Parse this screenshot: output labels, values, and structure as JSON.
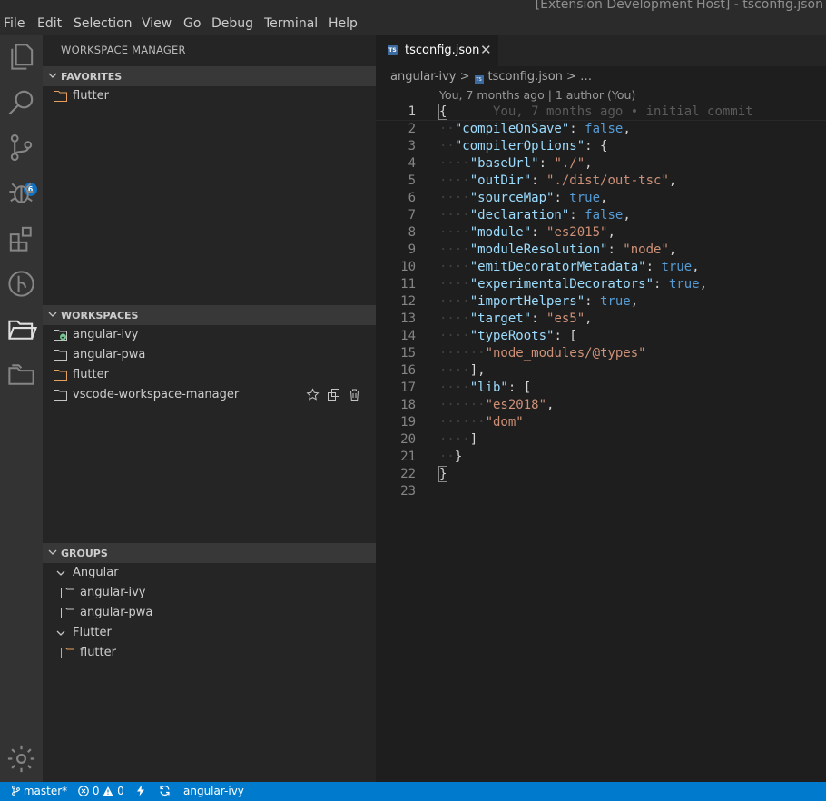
{
  "window_title": "[Extension Development Host] - tsconfig.json",
  "menu": [
    "File",
    "Edit",
    "Selection",
    "View",
    "Go",
    "Debug",
    "Terminal",
    "Help"
  ],
  "activity_bar": {
    "scm_badge": "6"
  },
  "sidebar": {
    "title": "WORKSPACE MANAGER",
    "favorites": {
      "header": "FAVORITES",
      "items": [
        "flutter"
      ]
    },
    "workspaces": {
      "header": "WORKSPACES",
      "items": [
        "angular-ivy",
        "angular-pwa",
        "flutter",
        "vscode-workspace-manager"
      ]
    },
    "groups": {
      "header": "GROUPS",
      "group1": {
        "label": "Angular",
        "items": [
          "angular-ivy",
          "angular-pwa"
        ]
      },
      "group2": {
        "label": "Flutter",
        "items": [
          "flutter"
        ]
      }
    }
  },
  "editor": {
    "tab": {
      "file_badge": "TS",
      "name": "tsconfig.json",
      "close": "✕"
    },
    "breadcrumb": {
      "folder": "angular-ivy",
      "sep": ">",
      "file": "tsconfig.json",
      "more": "> …"
    },
    "blame_header": "You, 7 months ago | 1 author (You)",
    "blame_inline": "You, 7 months ago • initial commit",
    "line_numbers": [
      "1",
      "2",
      "3",
      "4",
      "5",
      "6",
      "7",
      "8",
      "9",
      "10",
      "11",
      "12",
      "13",
      "14",
      "15",
      "16",
      "17",
      "18",
      "19",
      "20",
      "21",
      "22",
      "23"
    ],
    "code": {
      "l1": "{",
      "l2k": "\"compileOnSave\"",
      "l2v": "false",
      "l3k": "\"compilerOptions\"",
      "l3v": "{",
      "l4k": "\"baseUrl\"",
      "l4v": "\"./\"",
      "l5k": "\"outDir\"",
      "l5v": "\"./dist/out-tsc\"",
      "l6k": "\"sourceMap\"",
      "l6v": "true",
      "l7k": "\"declaration\"",
      "l7v": "false",
      "l8k": "\"module\"",
      "l8v": "\"es2015\"",
      "l9k": "\"moduleResolution\"",
      "l9v": "\"node\"",
      "l10k": "\"emitDecoratorMetadata\"",
      "l10v": "true",
      "l11k": "\"experimentalDecorators\"",
      "l11v": "true",
      "l12k": "\"importHelpers\"",
      "l12v": "true",
      "l13k": "\"target\"",
      "l13v": "\"es5\"",
      "l14k": "\"typeRoots\"",
      "l14v": "[",
      "l15v": "\"node_modules/@types\"",
      "l16": "],",
      "l17k": "\"lib\"",
      "l17v": "[",
      "l18v": "\"es2018\"",
      "l19v": "\"dom\"",
      "l20": "]",
      "l21": "}",
      "l22": "}"
    }
  },
  "statusbar": {
    "branch": "master*",
    "errors": "0",
    "warnings": "0",
    "folder": "angular-ivy"
  },
  "colors": {
    "accent": "#007acc",
    "folder_orange": "#e8a15c",
    "folder_gray": "#c5c5c5",
    "green": "#73c991"
  }
}
